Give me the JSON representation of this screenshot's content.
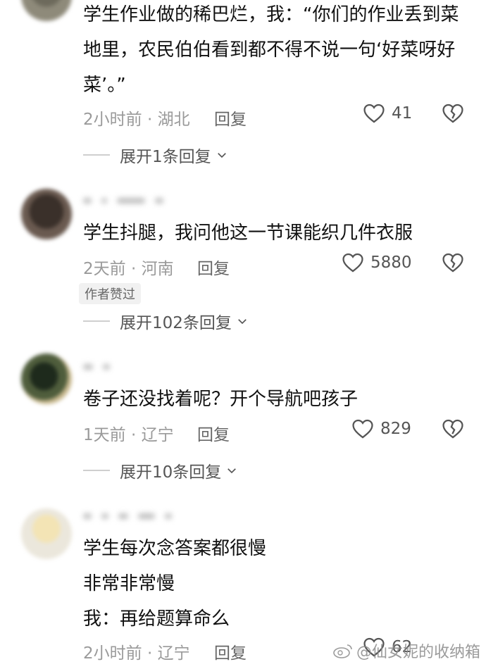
{
  "comments": [
    {
      "text": "学生作业做的稀巴烂，我：“你们的作业丢到菜地里，农民伯伯看到都不得不说一句‘好菜呀好菜’。”",
      "time_location": "2小时前 · 湖北",
      "reply_label": "回复",
      "likes": "41",
      "expand_label": "展开1条回复"
    },
    {
      "text": "学生抖腿，我问他这一节课能织几件衣服",
      "time_location": "2天前 · 河南",
      "reply_label": "回复",
      "likes": "5880",
      "badge": "作者赞过",
      "expand_label": "展开102条回复"
    },
    {
      "text": "卷子还没找着呢？开个导航吧孩子",
      "time_location": "1天前 · 辽宁",
      "reply_label": "回复",
      "likes": "829",
      "expand_label": "展开10条回复"
    },
    {
      "lines": [
        "学生每次念答案都很慢",
        "非常非常慢",
        "我：再给题算命么"
      ],
      "time_location": "2小时前 · 辽宁",
      "reply_label": "回复",
      "likes": "62"
    }
  ],
  "watermark": "@仙女妮的收纳箱",
  "colors": {
    "text": "#111111",
    "meta": "#9a9a9a",
    "badge_bg": "#f1f1f1"
  },
  "icons": [
    "heart-outline-icon",
    "broken-heart-icon",
    "chevron-down-icon",
    "weibo-icon"
  ]
}
